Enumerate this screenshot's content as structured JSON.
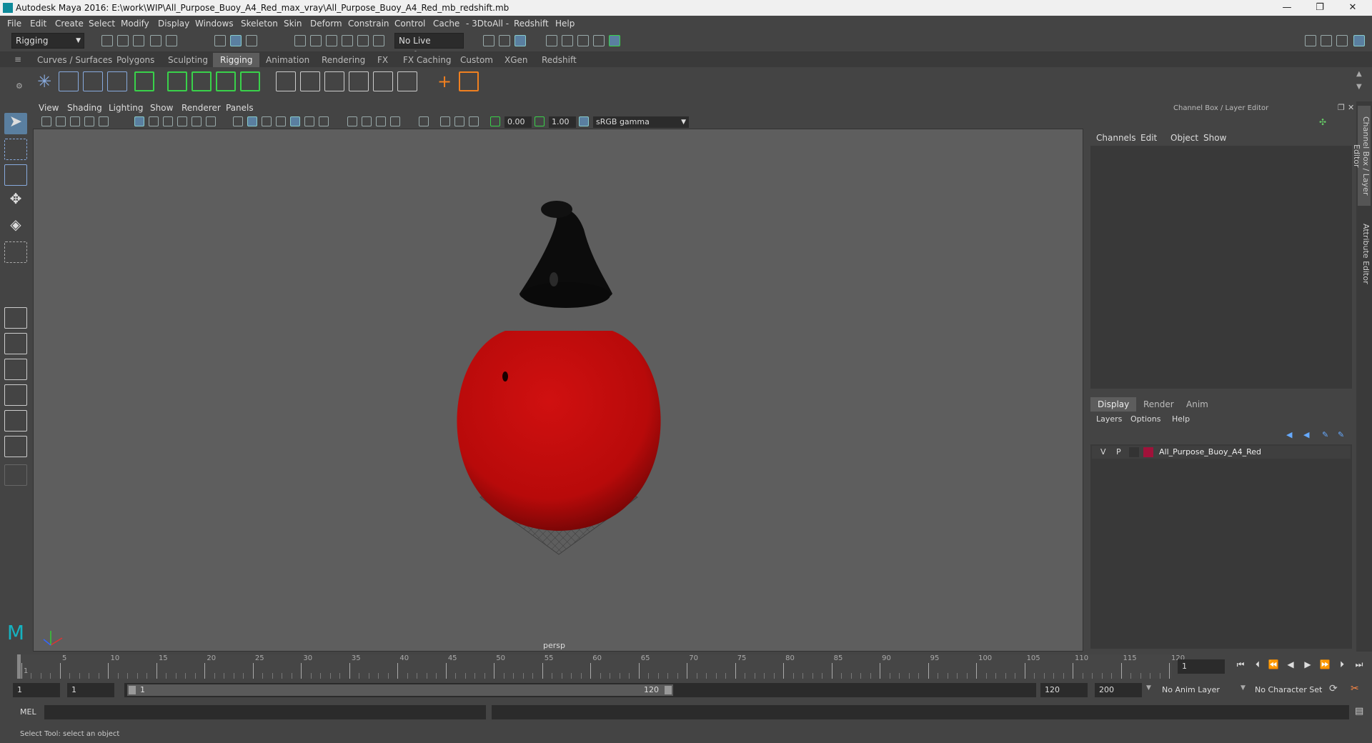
{
  "window": {
    "title": "Autodesk Maya 2016: E:\\work\\WIP\\All_Purpose_Buoy_A4_Red_max_vray\\All_Purpose_Buoy_A4_Red_mb_redshift.mb",
    "minimize": "—",
    "restore": "❐",
    "close": "✕"
  },
  "menubar": [
    "File",
    "Edit",
    "Create",
    "Select",
    "Modify",
    "Display",
    "Windows",
    "Skeleton",
    "Skin",
    "Deform",
    "Constrain",
    "Control",
    "Cache",
    "- 3DtoAll -",
    "Redshift",
    "Help"
  ],
  "statusline": {
    "menuset": "Rigging",
    "live_surface": "No Live Surface"
  },
  "shelf_tabs": [
    "Curves / Surfaces",
    "Polygons",
    "Sculpting",
    "Rigging",
    "Animation",
    "Rendering",
    "FX",
    "FX Caching",
    "Custom",
    "XGen",
    "Redshift"
  ],
  "active_shelf": "Rigging",
  "viewport": {
    "menus": [
      "View",
      "Shading",
      "Lighting",
      "Show",
      "Renderer",
      "Panels"
    ],
    "exposure": "0.00",
    "gamma": "1.00",
    "colorspace": "sRGB gamma",
    "camera_label": "persp"
  },
  "channelbox": {
    "title": "Channel Box / Layer Editor",
    "menus": [
      "Channels",
      "Edit",
      "Object",
      "Show"
    ],
    "layer_tabs": [
      "Display",
      "Render",
      "Anim"
    ],
    "active_layer_tab": "Display",
    "layer_menus": [
      "Layers",
      "Options",
      "Help"
    ],
    "layer": {
      "v": "V",
      "p": "P",
      "name": "All_Purpose_Buoy_A4_Red",
      "color": "#a0123a"
    }
  },
  "side_tabs": [
    "Channel Box / Layer Editor",
    "Attribute Editor"
  ],
  "timeslider": {
    "ticks": [
      "1",
      "5",
      "10",
      "15",
      "20",
      "25",
      "30",
      "35",
      "40",
      "45",
      "50",
      "55",
      "60",
      "65",
      "70",
      "75",
      "80",
      "85",
      "90",
      "95",
      "100",
      "105",
      "110",
      "115",
      "120"
    ],
    "current_frame": "1"
  },
  "range": {
    "start": "1",
    "playback_start": "1",
    "slider_start": "1",
    "slider_end": "120",
    "playback_end": "120",
    "end": "200",
    "anim_layer": "No Anim Layer",
    "character_set": "No Character Set"
  },
  "cmdline": {
    "label": "MEL"
  },
  "helpline": {
    "text": "Select Tool: select an object"
  },
  "colors": {
    "buoy_red": "#c40c0c",
    "buoy_cap": "#0c0c0c",
    "viewport_bg": "#5e5e5e"
  }
}
